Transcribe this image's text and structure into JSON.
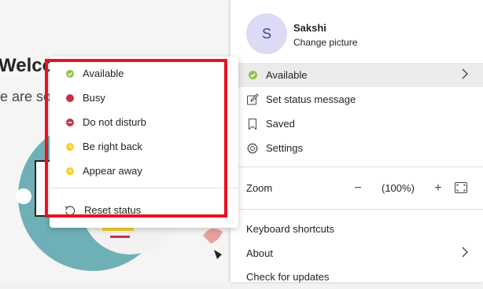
{
  "background": {
    "welcome": "Welco",
    "subtitle": "e are so"
  },
  "profile": {
    "avatar_initial": "S",
    "name": "Sakshi",
    "change_picture": "Change picture"
  },
  "menu": {
    "status": "Available",
    "set_status_message": "Set status message",
    "saved": "Saved",
    "settings": "Settings",
    "zoom_label": "Zoom",
    "zoom_minus": "−",
    "zoom_value": "(100%)",
    "zoom_plus": "+",
    "keyboard_shortcuts": "Keyboard shortcuts",
    "about": "About",
    "check_updates": "Check for updates"
  },
  "status_menu": {
    "items": [
      {
        "label": "Available",
        "color": "#92c353"
      },
      {
        "label": "Busy",
        "color": "#c4314b"
      },
      {
        "label": "Do not disturb",
        "color": "#c4314b"
      },
      {
        "label": "Be right back",
        "color": "#f8d22a"
      },
      {
        "label": "Appear away",
        "color": "#f8d22a"
      }
    ],
    "reset": "Reset status"
  },
  "colors": {
    "highlight_border": "#e81123",
    "available": "#92c353",
    "busy": "#c4314b",
    "away": "#f8d22a"
  }
}
